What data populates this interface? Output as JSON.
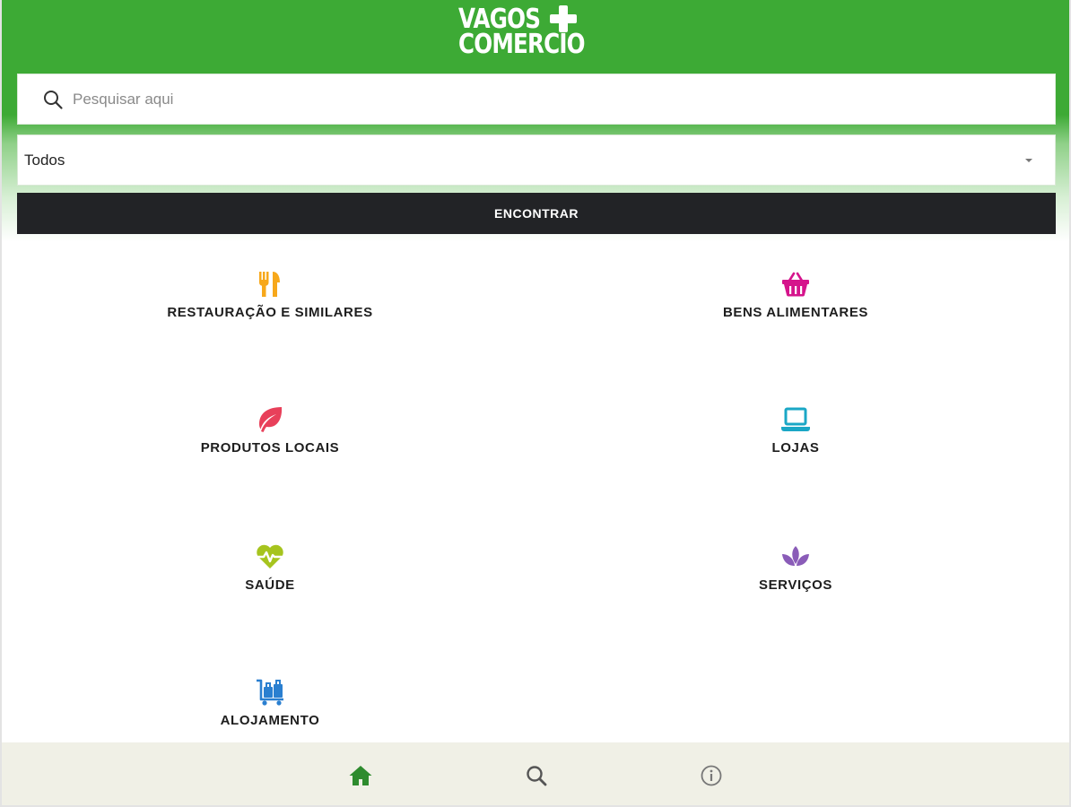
{
  "header": {
    "logo_line1": "VAGOS",
    "logo_line2": "COMERCIO",
    "background_color": "#3daa35"
  },
  "search": {
    "placeholder": "Pesquisar aqui",
    "value": ""
  },
  "filter": {
    "selected": "Todos"
  },
  "find_button": {
    "label": "ENCONTRAR"
  },
  "categories": [
    {
      "label": "RESTAURAÇÃO E SIMILARES",
      "icon": "fork-knife-icon",
      "color": "#f7a81b"
    },
    {
      "label": "BENS ALIMENTARES",
      "icon": "basket-icon",
      "color": "#d5148c"
    },
    {
      "label": "PRODUTOS LOCAIS",
      "icon": "leaf-icon",
      "color": "#e8405a"
    },
    {
      "label": "LOJAS",
      "icon": "laptop-icon",
      "color": "#1aa7c6"
    },
    {
      "label": "SAÚDE",
      "icon": "heartbeat-icon",
      "color": "#a6c41e"
    },
    {
      "label": "SERVIÇOS",
      "icon": "lotus-icon",
      "color": "#8a5cb8"
    },
    {
      "label": "ALOJAMENTO",
      "icon": "luggage-cart-icon",
      "color": "#2a7fd0"
    }
  ],
  "bottom_nav": {
    "items": [
      {
        "name": "home",
        "icon": "home-icon",
        "color": "#2e8b2e"
      },
      {
        "name": "search",
        "icon": "search-icon",
        "color": "#555555"
      },
      {
        "name": "info",
        "icon": "info-icon",
        "color": "#777777"
      }
    ]
  }
}
